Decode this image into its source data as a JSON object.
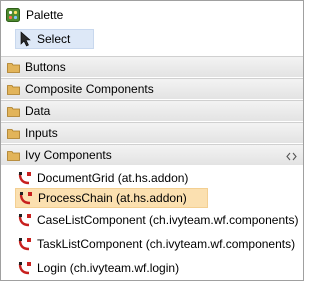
{
  "palette": {
    "title": "Palette",
    "select_tool": "Select",
    "drawers": [
      {
        "label": "Buttons"
      },
      {
        "label": "Composite Components"
      },
      {
        "label": "Data"
      },
      {
        "label": "Inputs"
      },
      {
        "label": "Ivy Components"
      }
    ],
    "components": [
      {
        "label": "DocumentGrid (at.hs.addon)"
      },
      {
        "label": "ProcessChain (at.hs.addon)",
        "selected": true
      },
      {
        "label": "CaseListComponent (ch.ivyteam.wf.components)"
      },
      {
        "label": "TaskListComponent (ch.ivyteam.wf.components)"
      },
      {
        "label": "Login (ch.ivyteam.wf.login)"
      }
    ]
  },
  "colors": {
    "select_highlight": "#dde8f7",
    "selected_entry": "#fbe0b0",
    "drawer_header": "#e9e9e9",
    "folder": "#e2b45a",
    "component_icon_red": "#c8201e"
  }
}
